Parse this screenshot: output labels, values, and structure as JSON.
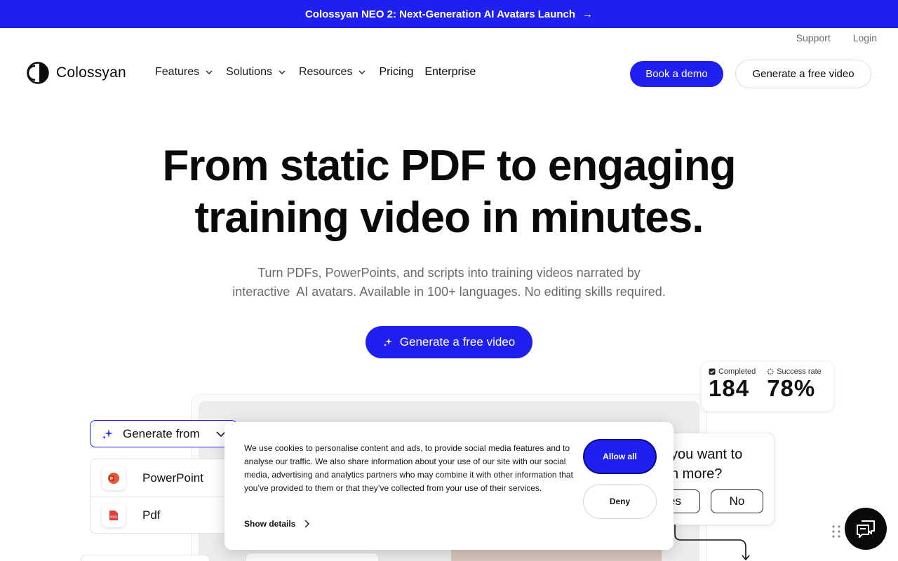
{
  "banner": {
    "text": "Colossyan NEO 2: Next-Generation AI Avatars Launch",
    "arrow": "→"
  },
  "top_links": {
    "support": "Support",
    "login": "Login"
  },
  "logo": {
    "text": "Colossyan"
  },
  "nav": {
    "features": "Features",
    "solutions": "Solutions",
    "resources": "Resources",
    "pricing": "Pricing",
    "enterprise": "Enterprise"
  },
  "header_buttons": {
    "book_demo": "Book a demo",
    "generate_free": "Generate a free video"
  },
  "hero": {
    "title_line1": "From static PDF to engaging",
    "title_line2": "training video in minutes.",
    "subtitle_line1": "Turn PDFs, PowerPoints, and scripts into training videos narrated by",
    "subtitle_line2": "interactive  AI avatars. Available in 100+ languages. No editing skills required.",
    "cta": "Generate a free video"
  },
  "stats": {
    "completed_label": "Completed",
    "completed_value": "184",
    "success_label": "Success rate",
    "success_value": "78%"
  },
  "generate_from": {
    "label": "Generate from",
    "items": [
      {
        "label": "PowerPoint"
      },
      {
        "label": "Pdf"
      }
    ]
  },
  "question": {
    "line1": "you want to",
    "line2": "n more?",
    "yes": "es",
    "no": "No"
  },
  "cookie": {
    "text": "We use cookies to personalise content and ads, to provide social media features and to analyse our traffic. We also share information about your use of our site with our social media, advertising and analytics partners who may combine it with other information that you’ve provided to them or that they’ve collected from your use of their services.",
    "show_details": "Show details",
    "allow_all": "Allow all",
    "deny": "Deny"
  },
  "colors": {
    "brand_blue": "#1f1ff0",
    "text_dark": "#0a0a0a",
    "muted": "#6a6a6a"
  }
}
